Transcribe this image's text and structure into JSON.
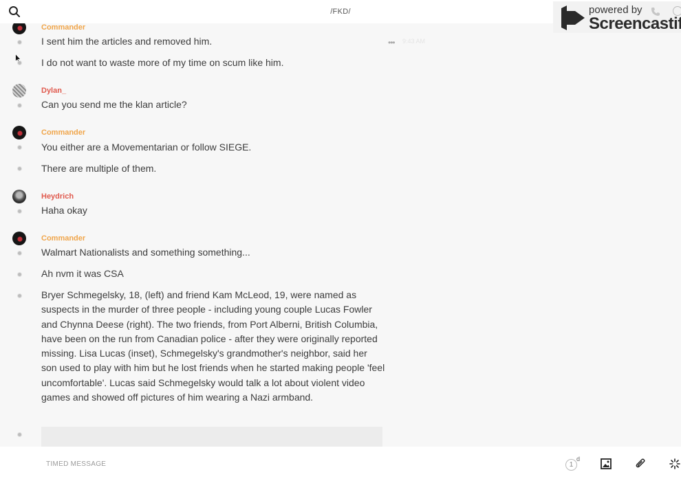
{
  "header": {
    "title": "/FKD/"
  },
  "watermark": {
    "line1": "powered by",
    "line2": "Screencastify"
  },
  "messages": [
    {
      "author": "Commander",
      "text": "I sent him the articles and removed him.",
      "time": "9:43 AM"
    },
    {
      "text": "I do not want to waste more of my time on scum like him."
    },
    {
      "author": "Dylan_",
      "text": "Can you send me the klan article?"
    },
    {
      "author": "Commander",
      "text": "You either are a Movementarian or follow SIEGE."
    },
    {
      "text": "There are multiple of them."
    },
    {
      "author": "Heydrich",
      "text": "Haha okay"
    },
    {
      "author": "Commander",
      "text": "Walmart Nationalists and something something..."
    },
    {
      "text": "Ah nvm it was CSA"
    },
    {
      "text": "Bryer Schmegelsky, 18, (left) and friend Kam McLeod, 19, were named as suspects in the murder of three people - including young couple Lucas Fowler and Chynna Deese (right). The two friends, from Port Alberni, British Columbia, have been on the run from Canadian police - after they were originally reported missing. Lisa Lucas (inset), Schmegelsky's grandmother's neighbor, said her son used to play with him but he lost friends when he started making people 'feel uncomfortable'. Lucas said Schmegelsky would talk a lot about violent video games and showed off pictures of him wearing a Nazi armband."
    }
  ],
  "composer": {
    "placeholder": "TIMED MESSAGE",
    "timer_value": "1",
    "timer_unit": "d"
  },
  "icons": [
    "search-icon",
    "phone-icon",
    "info-icon",
    "more-icon",
    "cursor-icon",
    "image-icon",
    "paperclip-icon",
    "loading-icon"
  ],
  "colors": {
    "author_orange": "#f0a54a",
    "author_red": "#e05a4e"
  }
}
